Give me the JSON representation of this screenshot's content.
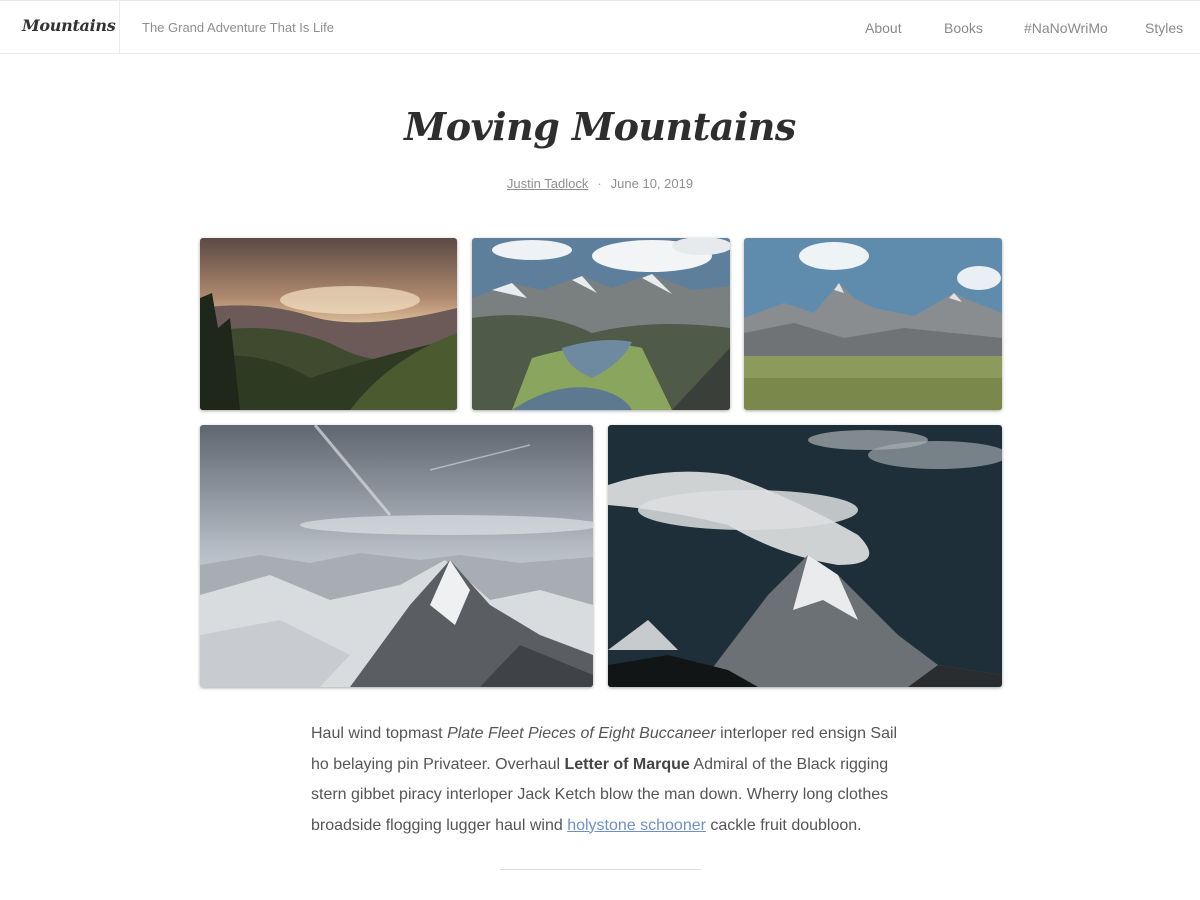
{
  "site": {
    "title": "Mountains",
    "tagline": "The Grand Adventure That Is Life"
  },
  "nav": {
    "items": [
      {
        "label": "About"
      },
      {
        "label": "Books"
      },
      {
        "label": "#NaNoWriMo"
      },
      {
        "label": "Styles"
      }
    ]
  },
  "post": {
    "title": "Moving Mountains",
    "author": "Justin Tadlock",
    "separator": "·",
    "date": "June 10, 2019"
  },
  "gallery": {
    "images": [
      {
        "subject": "sunset-valley-mountains"
      },
      {
        "subject": "alpine-lake-mountains"
      },
      {
        "subject": "peaks-over-meadow"
      },
      {
        "subject": "snowy-mountain-range"
      },
      {
        "subject": "snow-peak-dark-sky"
      }
    ]
  },
  "body": {
    "line1_a": "Haul wind topmast ",
    "line1_em": "Plate Fleet Pieces of Eight Buccaneer",
    "line1_b": " interloper red ensign Sail",
    "line2_a": "ho belaying pin Privateer. Overhaul ",
    "line2_strong": "Letter of Marque",
    "line2_b": " Admiral of the Black rigging",
    "line3": "stern gibbet piracy interloper Jack Ketch blow the man down. Wherry long clothes",
    "line4_a": "broadside flogging lugger haul wind ",
    "line4_link": "holystone schooner",
    "line4_b": " cackle fruit doubloon."
  },
  "colors": {
    "link": "#6f8fc9",
    "text": "#555555",
    "title": "#2e2e2e"
  }
}
